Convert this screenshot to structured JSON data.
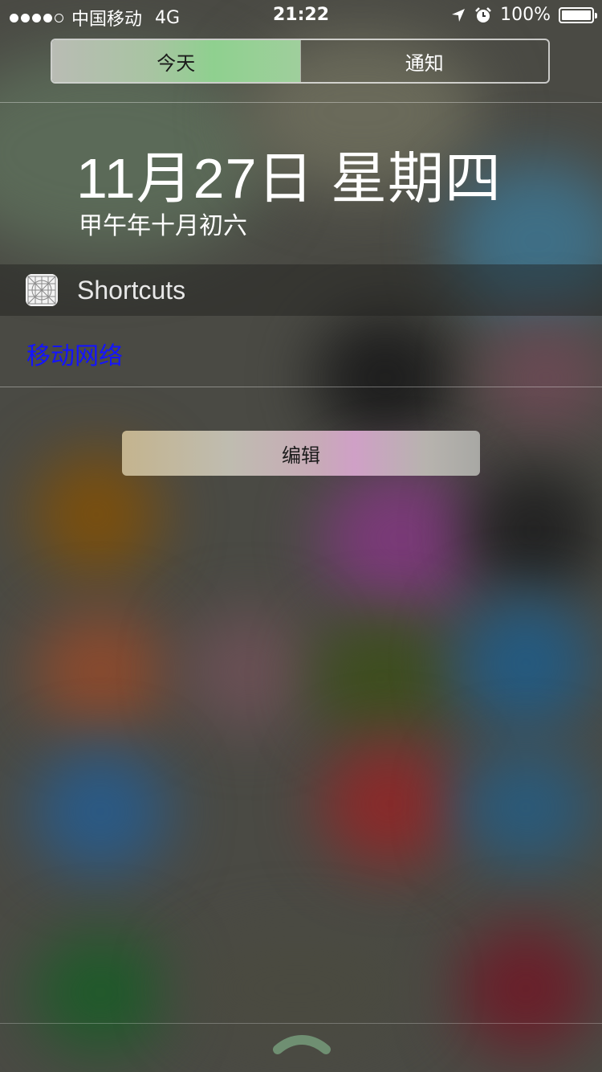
{
  "status_bar": {
    "signal_dots_filled": 4,
    "signal_dots_total": 5,
    "carrier": "中国移动",
    "network": "4G",
    "time": "21:22",
    "battery_text": "100%",
    "battery_level": 1.0,
    "icons": [
      "location-arrow-icon",
      "alarm-clock-icon",
      "battery-icon"
    ]
  },
  "segmented_control": {
    "tabs": [
      {
        "label": "今天",
        "active": true
      },
      {
        "label": "通知",
        "active": false
      }
    ]
  },
  "today": {
    "date": "11月27日 星期四",
    "lunar_date": "甲午年十月初六"
  },
  "widget": {
    "icon": "shortcuts-grid-icon",
    "title": "Shortcuts",
    "link": "移动网络"
  },
  "edit_button": {
    "label": "编辑"
  },
  "bottom": {
    "icon": "chevron-up-handle-icon"
  },
  "colors": {
    "link": "#1414ff",
    "active_tab_green": "#8fd08f",
    "background": "#4a4a44"
  }
}
